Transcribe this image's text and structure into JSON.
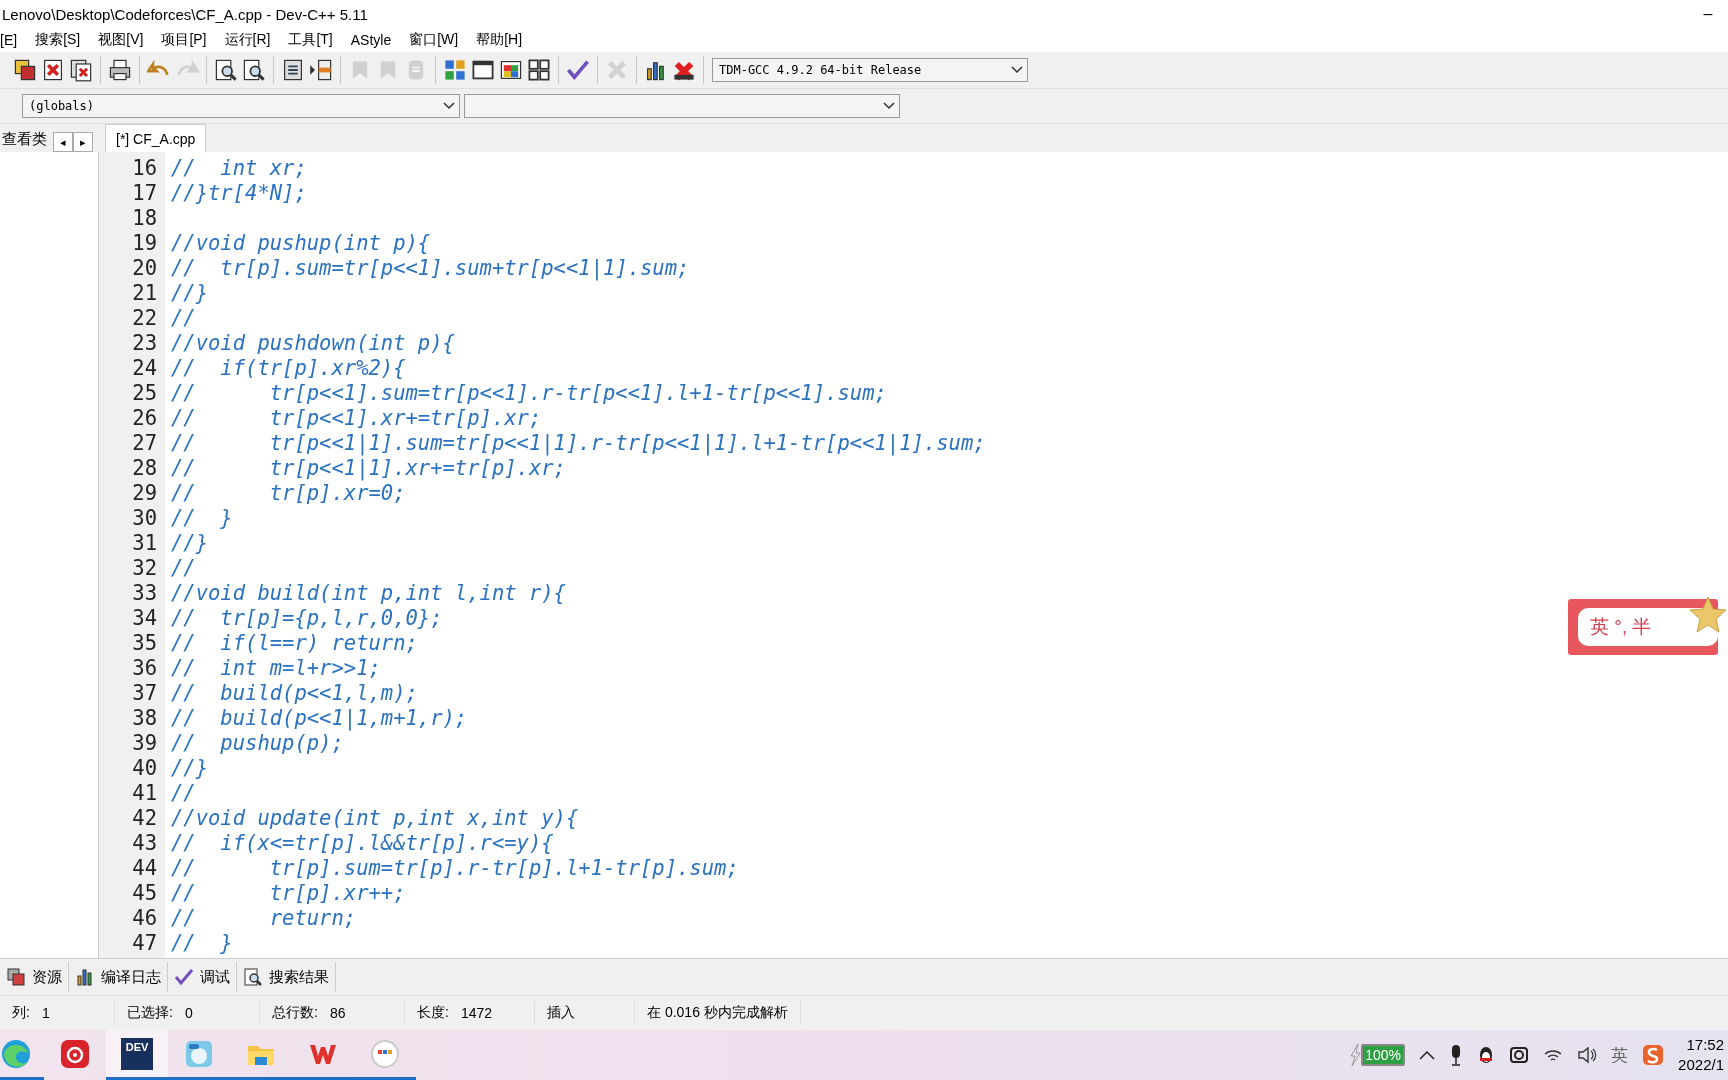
{
  "window": {
    "title": "Lenovo\\Desktop\\Codeforces\\CF_A.cpp - Dev-C++ 5.11",
    "minimize": "–"
  },
  "menu": [
    {
      "label": "[E]"
    },
    {
      "label": "搜索[S]"
    },
    {
      "label": "视图[V]"
    },
    {
      "label": "项目[P]"
    },
    {
      "label": "运行[R]"
    },
    {
      "label": "工具[T]"
    },
    {
      "label": "AStyle"
    },
    {
      "label": "窗口[W]"
    },
    {
      "label": "帮助[H]"
    }
  ],
  "toolbar": {
    "groups": [
      [
        {
          "kind": "stack",
          "disabled": false
        },
        {
          "kind": "close-red",
          "disabled": false
        },
        {
          "kind": "close-all",
          "disabled": false
        }
      ],
      [
        {
          "kind": "print",
          "disabled": false
        }
      ],
      [
        {
          "kind": "undo",
          "disabled": false
        },
        {
          "kind": "redo",
          "disabled": true
        }
      ],
      [
        {
          "kind": "find",
          "disabled": false
        },
        {
          "kind": "find",
          "disabled": false
        }
      ],
      [
        {
          "kind": "list",
          "disabled": false
        },
        {
          "kind": "indent",
          "disabled": false
        }
      ],
      [
        {
          "kind": "bookmark",
          "disabled": true
        },
        {
          "kind": "bookmark",
          "disabled": true
        },
        {
          "kind": "shield",
          "disabled": true
        }
      ],
      [
        {
          "kind": "tiles",
          "disabled": false
        },
        {
          "kind": "window",
          "disabled": false
        },
        {
          "kind": "colors",
          "disabled": false
        },
        {
          "kind": "grid",
          "disabled": false
        }
      ],
      [
        {
          "kind": "check",
          "disabled": false
        }
      ],
      [
        {
          "kind": "cross",
          "disabled": true
        }
      ],
      [
        {
          "kind": "chart",
          "disabled": false
        },
        {
          "kind": "stop",
          "disabled": false
        }
      ]
    ],
    "compiler": "TDM-GCC 4.9.2 64-bit Release"
  },
  "scope_bar": {
    "scope": "(globals)"
  },
  "left_panel": {
    "tab": "查看类",
    "prev": "◂",
    "next": "▸"
  },
  "editor_tabs": [
    {
      "label": "[*] CF_A.cpp",
      "selected": true
    }
  ],
  "code": [
    {
      "number": "16",
      "text": "//  int xr;"
    },
    {
      "number": "17",
      "text": "//}tr[4*N];"
    },
    {
      "number": "18"
    },
    {
      "number": "19",
      "text": "//void pushup(int p){"
    },
    {
      "number": "20",
      "text": "//  tr[p].sum=tr[p<<1].sum+tr[p<<1|1].sum;"
    },
    {
      "number": "21",
      "text": "//}"
    },
    {
      "number": "22",
      "text": "//"
    },
    {
      "number": "23",
      "text": "//void pushdown(int p){"
    },
    {
      "number": "24",
      "text": "//  if(tr[p].xr%2){"
    },
    {
      "number": "25",
      "text": "//      tr[p<<1].sum=tr[p<<1].r-tr[p<<1].l+1-tr[p<<1].sum;"
    },
    {
      "number": "26",
      "text": "//      tr[p<<1].xr+=tr[p].xr;"
    },
    {
      "number": "27",
      "text": "//      tr[p<<1|1].sum=tr[p<<1|1].r-tr[p<<1|1].l+1-tr[p<<1|1].sum;"
    },
    {
      "number": "28",
      "text": "//      tr[p<<1|1].xr+=tr[p].xr;"
    },
    {
      "number": "29",
      "text": "//      tr[p].xr=0;"
    },
    {
      "number": "30",
      "text": "//  }"
    },
    {
      "number": "31",
      "text": "//}"
    },
    {
      "number": "32",
      "text": "//"
    },
    {
      "number": "33",
      "text": "//void build(int p,int l,int r){"
    },
    {
      "number": "34",
      "text": "//  tr[p]={p,l,r,0,0};"
    },
    {
      "number": "35",
      "text": "//  if(l==r) return;"
    },
    {
      "number": "36",
      "text": "//  int m=l+r>>1;"
    },
    {
      "number": "37",
      "text": "//  build(p<<1,l,m);"
    },
    {
      "number": "38",
      "text": "//  build(p<<1|1,m+1,r);"
    },
    {
      "number": "39",
      "text": "//  pushup(p);"
    },
    {
      "number": "40",
      "text": "//}"
    },
    {
      "number": "41",
      "text": "//"
    },
    {
      "number": "42",
      "text": "//void update(int p,int x,int y){"
    },
    {
      "number": "43",
      "text": "//  if(x<=tr[p].l&&tr[p].r<=y){"
    },
    {
      "number": "44",
      "text": "//      tr[p].sum=tr[p].r-tr[p].l+1-tr[p].sum;"
    },
    {
      "number": "45",
      "text": "//      tr[p].xr++;"
    },
    {
      "number": "46",
      "text": "//      return;"
    },
    {
      "number": "47",
      "text": "//  }"
    }
  ],
  "ime_popup": {
    "text": "英 °, 半"
  },
  "bottom_tabs": [
    {
      "kind": "resources",
      "label": "资源"
    },
    {
      "kind": "compile-log",
      "label": "编译日志"
    },
    {
      "kind": "debug",
      "label": "调试"
    },
    {
      "kind": "search",
      "label": "搜索结果"
    }
  ],
  "status_bar": [
    {
      "label": "列:",
      "value": "1"
    },
    {
      "label": "已选择:",
      "value": "0"
    },
    {
      "label": "总行数:",
      "value": "86"
    },
    {
      "label": "长度:",
      "value": "1472"
    },
    {
      "value": "插入"
    },
    {
      "value": "在 0.016 秒内完成解析"
    }
  ],
  "taskbar": {
    "apps": [
      {
        "kind": "browser",
        "selected": false,
        "running": true
      },
      {
        "kind": "music",
        "selected": false,
        "running": false
      },
      {
        "kind": "ide",
        "label": "DEV",
        "selected": true,
        "running": true
      },
      {
        "kind": "wallpaper",
        "selected": false,
        "running": true
      },
      {
        "kind": "folder",
        "selected": false,
        "running": true
      },
      {
        "kind": "office",
        "selected": false,
        "running": true
      },
      {
        "kind": "badge",
        "selected": false,
        "running": true
      }
    ],
    "battery": "100%",
    "ime": "英",
    "time": "17:52",
    "date": "2022/1"
  }
}
